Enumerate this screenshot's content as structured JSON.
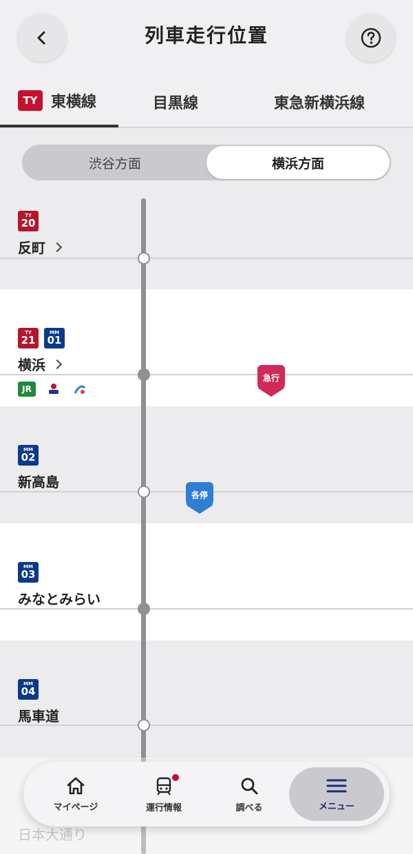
{
  "header": {
    "title": "列車走行位置"
  },
  "tabs": [
    {
      "badge": "TY",
      "label": "東横線"
    },
    {
      "label": "目黒線"
    },
    {
      "label": "東急新横浜線"
    }
  ],
  "direction": {
    "left": "渋谷方面",
    "right": "横浜方面",
    "selected": "横浜方面"
  },
  "stations": [
    {
      "codes": [
        {
          "line": "TY",
          "num": "20"
        }
      ],
      "name": "反町"
    },
    {
      "codes": [
        {
          "line": "TY",
          "num": "21"
        },
        {
          "line": "MM",
          "num": "01"
        }
      ],
      "name": "横浜"
    },
    {
      "codes": [
        {
          "line": "MM",
          "num": "02"
        }
      ],
      "name": "新高島"
    },
    {
      "codes": [
        {
          "line": "MM",
          "num": "03"
        }
      ],
      "name": "みなとみらい"
    },
    {
      "codes": [
        {
          "line": "MM",
          "num": "04"
        }
      ],
      "name": "馬車道"
    },
    {
      "name": "日本大通り"
    }
  ],
  "operators": {
    "jr": "JR"
  },
  "trains": [
    {
      "type": "急行",
      "color": "#cf2a58"
    },
    {
      "type": "各停",
      "color": "#2e7ed6"
    }
  ],
  "nav": [
    {
      "label": "マイページ",
      "icon": "home-icon"
    },
    {
      "label": "運行情報",
      "icon": "train-icon"
    },
    {
      "label": "調べる",
      "icon": "search-icon"
    },
    {
      "label": "メニュー",
      "icon": "menu-icon"
    }
  ]
}
